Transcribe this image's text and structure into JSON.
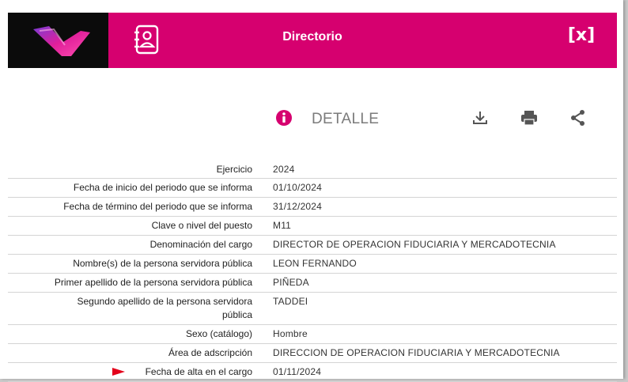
{
  "header": {
    "title": "Directorio",
    "close_label": "[x]"
  },
  "detail": {
    "label": "DETALLE"
  },
  "rows": [
    {
      "label": "Ejercicio",
      "value": "2024"
    },
    {
      "label": "Fecha de inicio del periodo que se informa",
      "value": "01/10/2024"
    },
    {
      "label": "Fecha de término del periodo que se informa",
      "value": "31/12/2024"
    },
    {
      "label": "Clave o nivel del puesto",
      "value": "M11"
    },
    {
      "label": "Denominación del cargo",
      "value": "DIRECTOR DE OPERACION FIDUCIARIA Y MERCADOTECNIA"
    },
    {
      "label": "Nombre(s) de la persona servidora pública",
      "value": "LEON FERNANDO"
    },
    {
      "label": "Primer apellido de la persona servidora pública",
      "value": "PIÑEDA"
    },
    {
      "label": "Segundo apellido de la persona servidora pública",
      "value": "TADDEI"
    },
    {
      "label": "Sexo (catálogo)",
      "value": "Hombre"
    },
    {
      "label": "Área de adscripción",
      "value": "DIRECCION DE OPERACION FIDUCIARIA Y MERCADOTECNIA"
    },
    {
      "label": "Fecha de alta en el cargo",
      "value": "01/11/2024"
    }
  ],
  "colors": {
    "brand": "#d6006f",
    "flag": "#e3001b"
  },
  "icons": [
    "logo-icon",
    "directory-icon",
    "close-icon",
    "info-icon",
    "download-icon",
    "print-icon",
    "share-icon",
    "flag-icon"
  ]
}
